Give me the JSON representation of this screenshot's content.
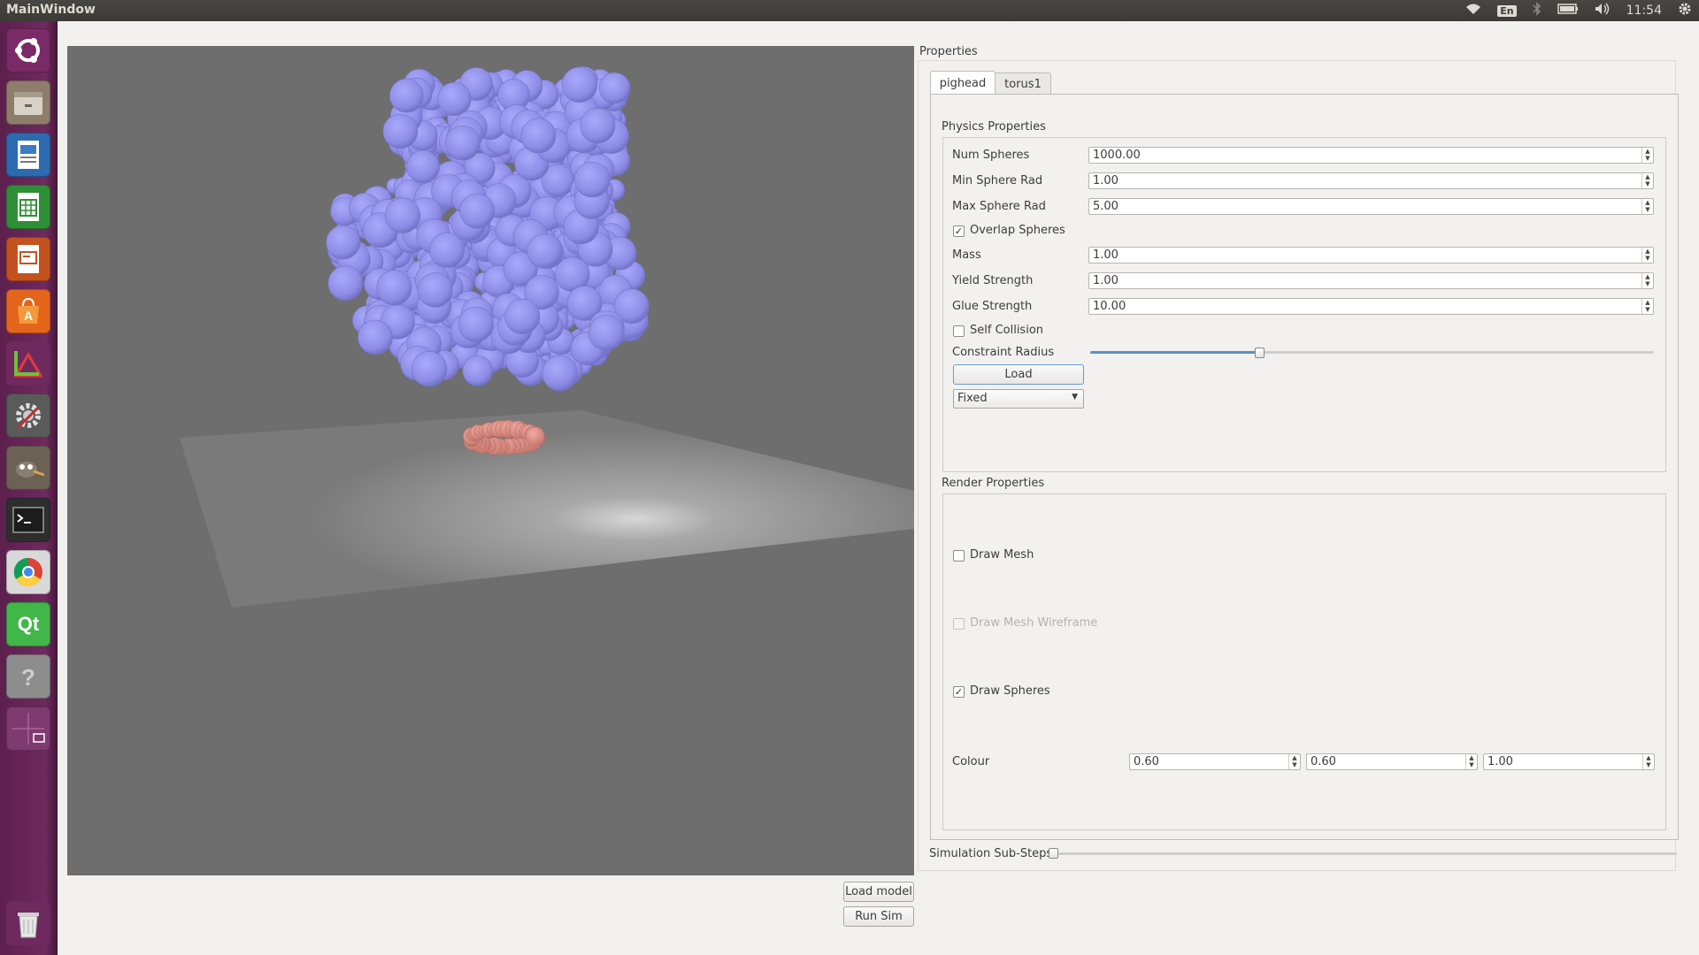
{
  "window": {
    "title": "MainWindow"
  },
  "tray": {
    "keyboard": "En",
    "time": "11:54"
  },
  "launcher": {
    "items": [
      "ubuntu-dash-icon",
      "files-icon",
      "writer-icon",
      "calc-icon",
      "impress-icon",
      "software-center-icon",
      "cad-icon",
      "settings-icon",
      "gimp-icon",
      "terminal-icon",
      "chrome-icon",
      "qt-creator-icon",
      "help-icon",
      "workspaces-icon",
      "trash-icon"
    ],
    "qt_label": "Qt"
  },
  "buttons": {
    "load_model": "Load model",
    "run_sim": "Run Sim"
  },
  "properties": {
    "title": "Properties",
    "tabs": [
      {
        "label": "pighead",
        "active": true
      },
      {
        "label": "torus1",
        "active": false
      }
    ],
    "physics": {
      "title": "Physics Properties",
      "num_spheres_label": "Num Spheres",
      "num_spheres": "1000.00",
      "min_rad_label": "Min Sphere Rad",
      "min_rad": "1.00",
      "max_rad_label": "Max Sphere Rad",
      "max_rad": "5.00",
      "overlap_label": "Overlap Spheres",
      "overlap_checked": true,
      "mass_label": "Mass",
      "mass": "1.00",
      "yield_label": "Yield Strength",
      "yield": "1.00",
      "glue_label": "Glue Strength",
      "glue": "10.00",
      "self_collision_label": "Self Collision",
      "self_collision_checked": false,
      "constraint_label": "Constraint Radius",
      "constraint_level": 0.3,
      "load_label": "Load",
      "mode_value": "Fixed"
    },
    "render": {
      "title": "Render Properties",
      "draw_mesh_label": "Draw Mesh",
      "draw_mesh_checked": false,
      "wireframe_label": "Draw Mesh Wireframe",
      "wireframe_checked": false,
      "draw_spheres_label": "Draw Spheres",
      "draw_spheres_checked": true,
      "colour_label": "Colour",
      "colour": [
        "0.60",
        "0.60",
        "1.00"
      ]
    },
    "substeps_label": "Simulation Sub-Steps",
    "substeps_level": 0
  },
  "scene": {
    "background": "#6e6e6e",
    "sphere_color": "#9a9af2",
    "torus_color": "#e8948a",
    "floor_color": "#7d7d7d"
  }
}
